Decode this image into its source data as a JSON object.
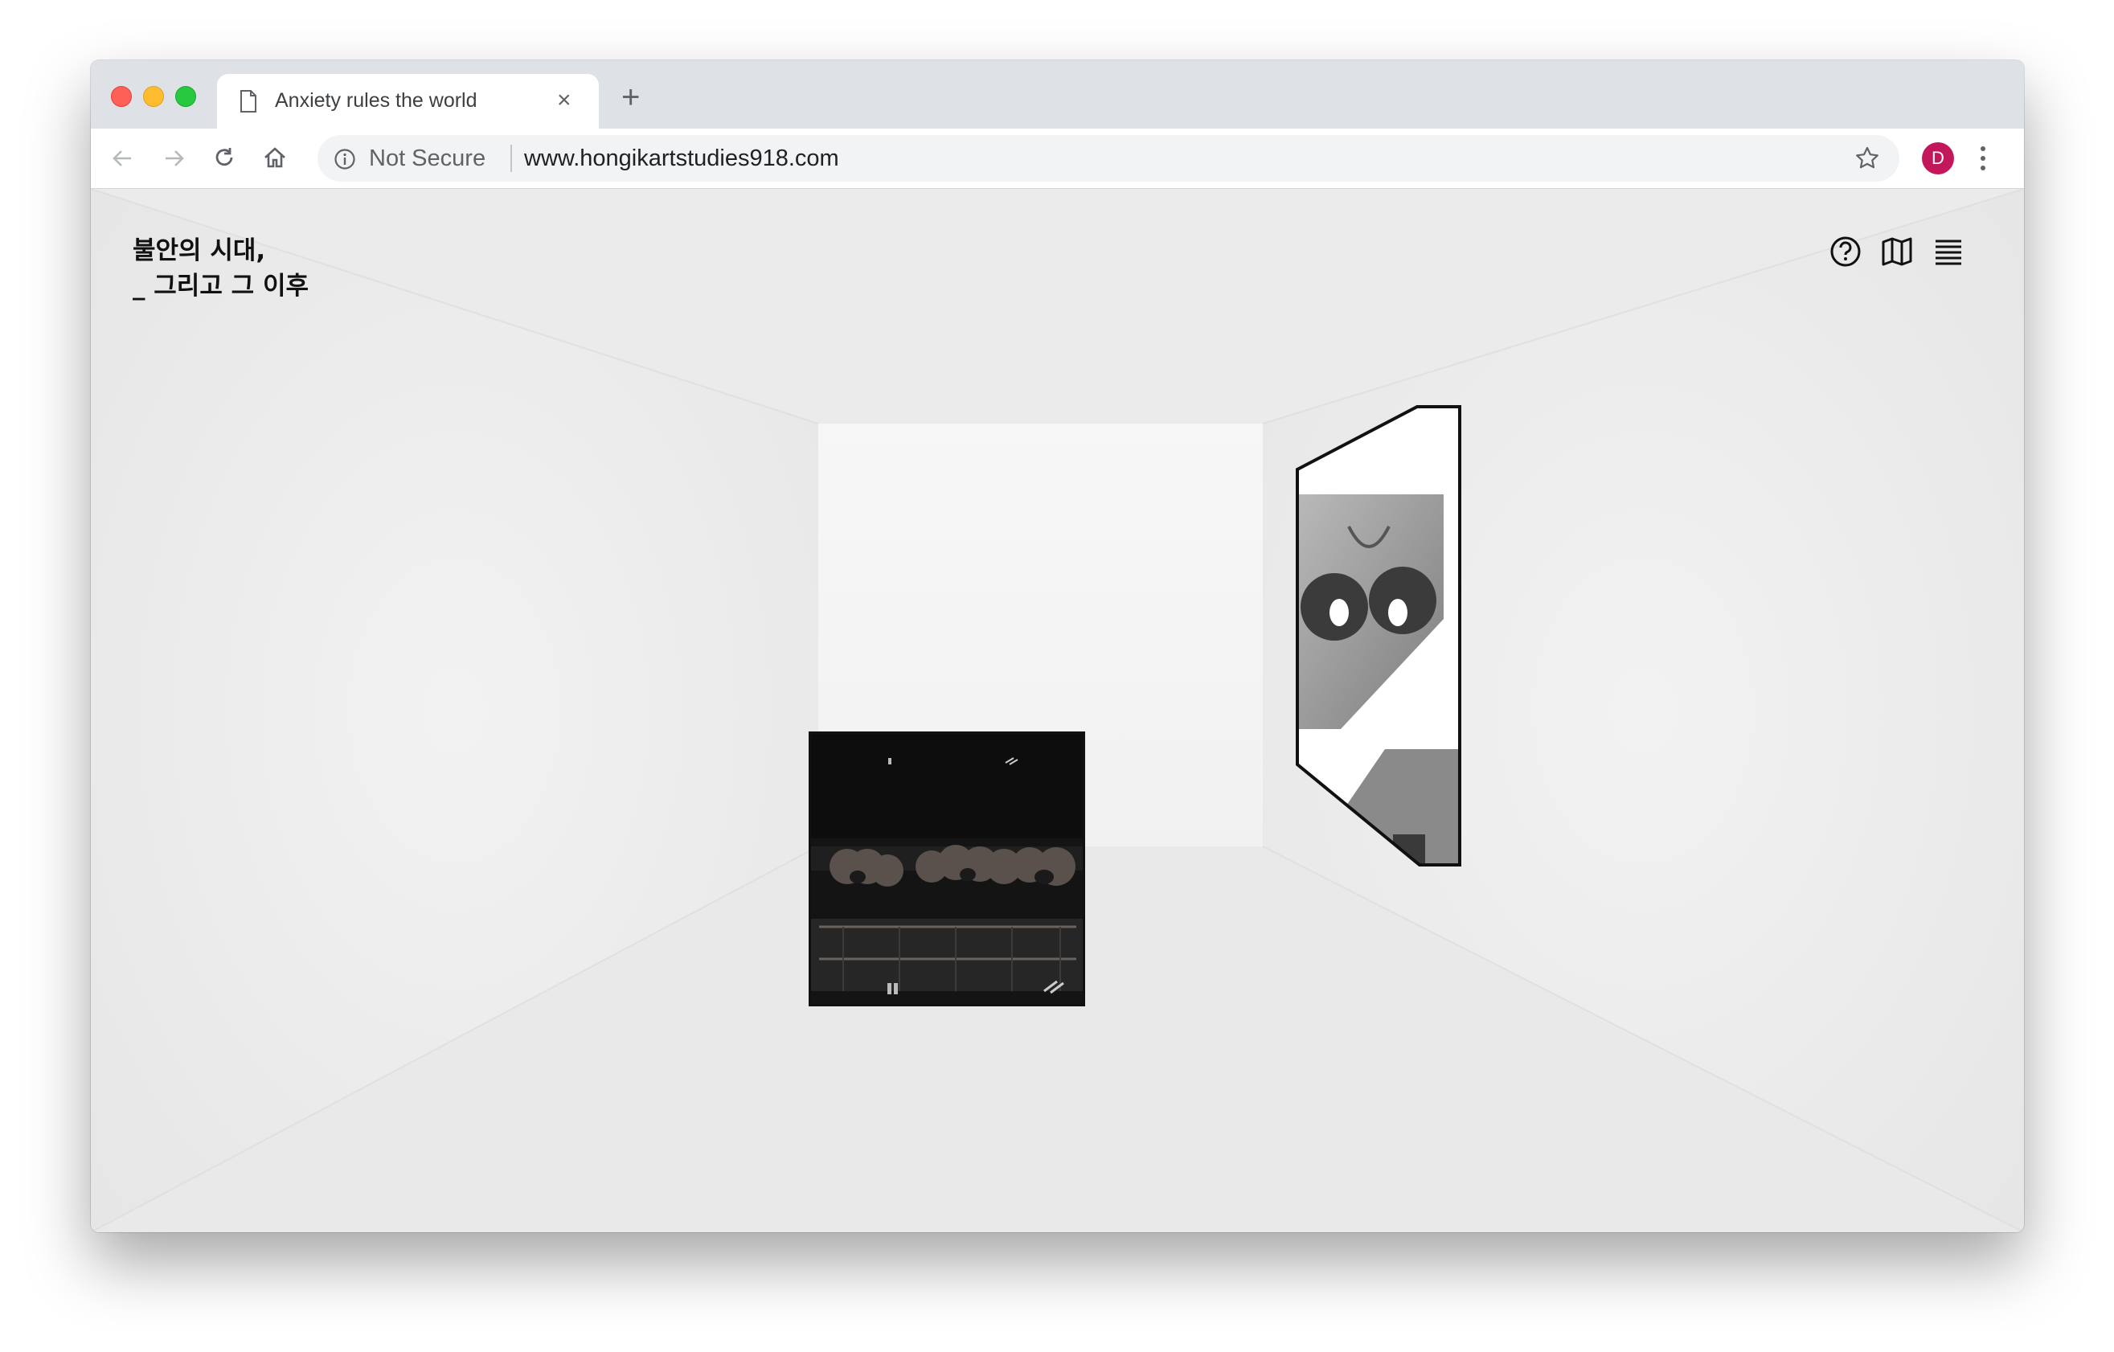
{
  "browser": {
    "tab": {
      "title": "Anxiety rules the world"
    },
    "omnibox": {
      "security_label": "Not Secure",
      "url": "www.hongikartstudies918.com"
    },
    "profile": {
      "initial": "D",
      "color": "#c2185b"
    }
  },
  "site": {
    "title_line1": "불안의 시대,",
    "title_line2": "_ 그리고 그 이후",
    "header_icons": [
      "help-icon",
      "map-icon",
      "list-menu-icon"
    ]
  },
  "gallery": {
    "artworks": [
      {
        "name": "artwork-classroom",
        "wall": "back-wall"
      },
      {
        "name": "artwork-drawing",
        "wall": "right-wall"
      }
    ]
  },
  "colors": {
    "room_background": "#ececec",
    "back_wall": "#f5f5f5",
    "frame_border": "#111111",
    "tab_strip": "#dee1e6"
  }
}
